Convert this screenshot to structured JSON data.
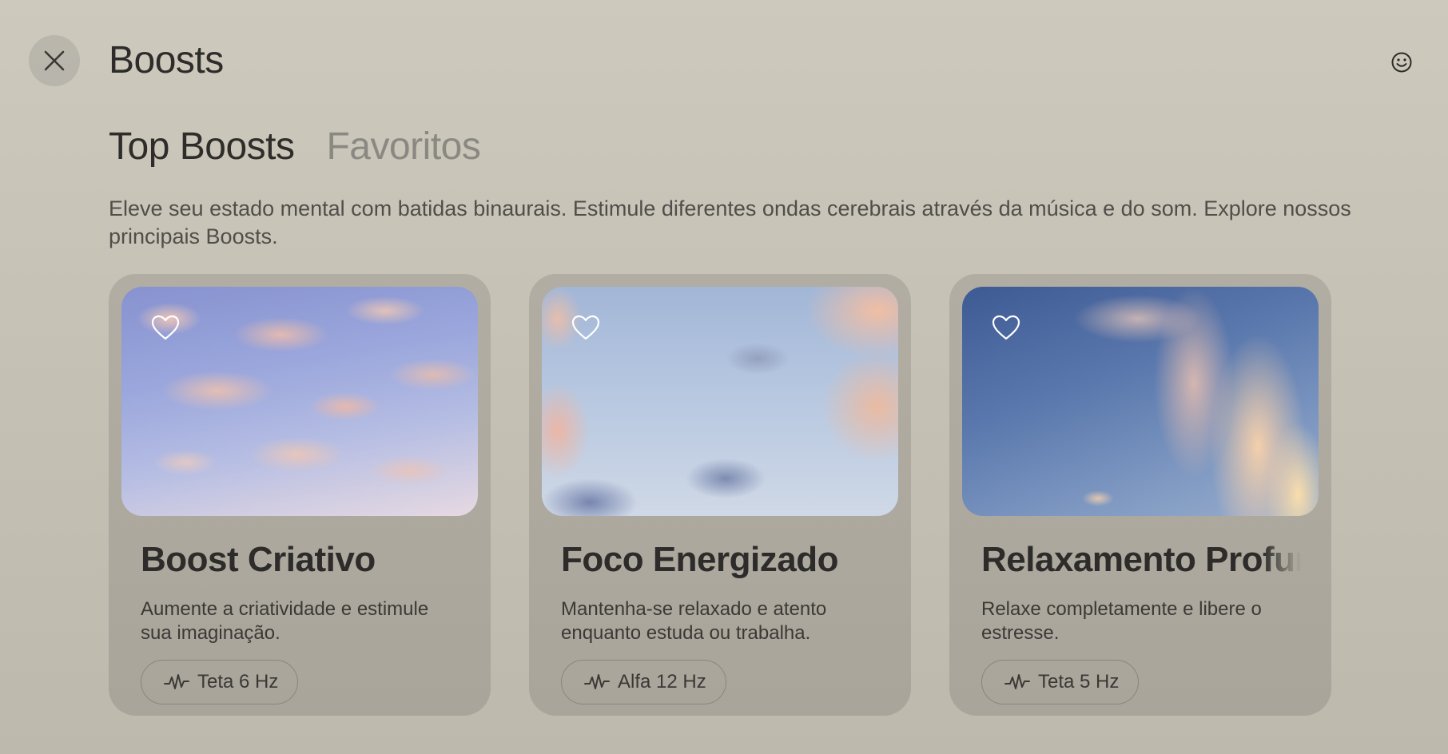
{
  "header": {
    "title": "Boosts",
    "close_icon": "close-icon",
    "smiley_icon": "smiley-icon"
  },
  "tabs": [
    {
      "label": "Top Boosts",
      "active": true
    },
    {
      "label": "Favoritos",
      "active": false
    }
  ],
  "description": "Eleve seu estado mental com batidas binaurais. Estimule diferentes ondas cerebrais através da música e do som. Explore nossos principais Boosts.",
  "cards": [
    {
      "title": "Boost Criativo",
      "description": "Aumente a criatividade e estimule sua imaginação.",
      "frequency": "Teta 6 Hz",
      "favorite_icon": "heart-outline-icon",
      "frequency_icon": "waveform-icon"
    },
    {
      "title": "Foco Energizado",
      "description": "Mantenha-se relaxado e atento enquanto estuda ou trabalha.",
      "frequency": "Alfa 12 Hz",
      "favorite_icon": "heart-outline-icon",
      "frequency_icon": "waveform-icon"
    },
    {
      "title": "Relaxamento Profundo",
      "description": "Relaxe completamente e libere o estresse.",
      "frequency": "Teta 5 Hz",
      "favorite_icon": "heart-outline-icon",
      "frequency_icon": "waveform-icon"
    }
  ],
  "colors": {
    "background": "#c9c5b9",
    "card": "#a9a59b",
    "text": "#2d2c2a",
    "inactive_tab": "#8a8882"
  }
}
